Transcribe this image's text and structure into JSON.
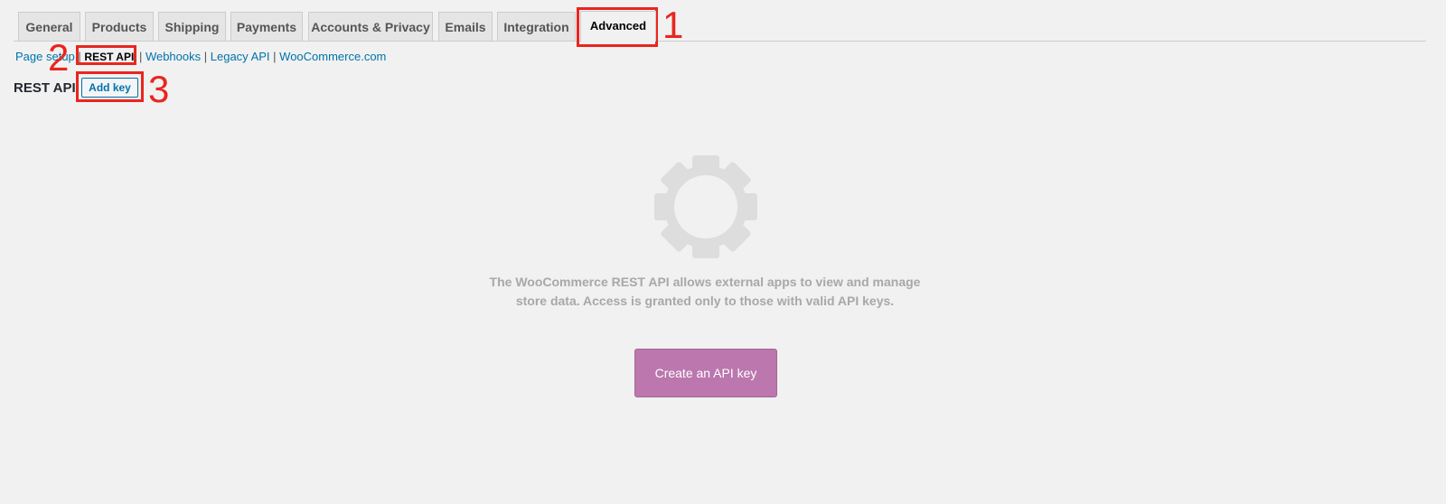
{
  "tabs": [
    {
      "label": "General"
    },
    {
      "label": "Products"
    },
    {
      "label": "Shipping"
    },
    {
      "label": "Payments"
    },
    {
      "label": "Accounts & Privacy"
    },
    {
      "label": "Emails"
    },
    {
      "label": "Integration"
    },
    {
      "label": "Advanced",
      "active": true
    }
  ],
  "subnav": {
    "items": [
      {
        "label": "Page setup"
      },
      {
        "label": "REST API",
        "current": true
      },
      {
        "label": "Webhooks"
      },
      {
        "label": "Legacy API"
      },
      {
        "label": "WooCommerce.com"
      }
    ],
    "separator": "|"
  },
  "heading": {
    "title": "REST API",
    "add_key_label": "Add key"
  },
  "empty_state": {
    "icon": "gear-icon",
    "message": "The WooCommerce REST API allows external apps to view and manage store data. Access is granted only to those with valid API keys.",
    "button_label": "Create an API key"
  },
  "annotations": {
    "step1": "1",
    "step2": "2",
    "step3": "3"
  },
  "colors": {
    "background": "#f1f1f1",
    "link": "#0073aa",
    "woo_purple": "#bb77ae",
    "annotation_red": "#e8261f",
    "muted_text": "#a8a8a8"
  }
}
